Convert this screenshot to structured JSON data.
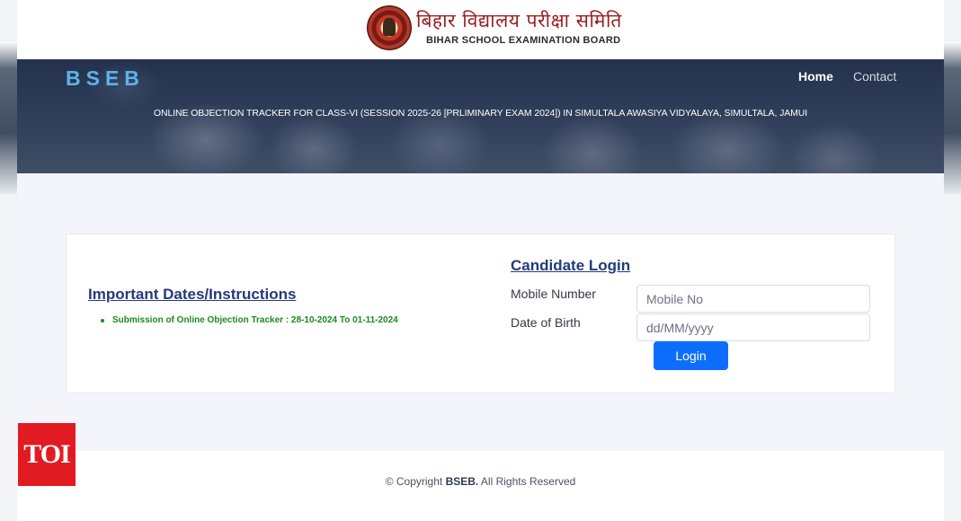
{
  "header": {
    "logo_hindi": "बिहार विद्यालय परीक्षा समिति",
    "logo_english": "BIHAR SCHOOL EXAMINATION BOARD"
  },
  "navbar": {
    "brand": "BSEB",
    "home_label": "Home",
    "contact_label": "Contact"
  },
  "hero": {
    "title": "ONLINE OBJECTION TRACKER FOR CLASS-VI (SESSION 2025-26 [PRLIMINARY EXAM 2024]) IN SIMULTALA AWASIYA VIDYALAYA, SIMULTALA, JAMUI"
  },
  "instructions": {
    "title": "Important Dates/Instructions",
    "items": [
      "Submission of Online Objection Tracker : 28-10-2024 To 01-11-2024"
    ]
  },
  "login": {
    "title": "Candidate Login",
    "mobile_label": "Mobile Number",
    "mobile_placeholder": "Mobile No",
    "dob_label": "Date of Birth",
    "dob_placeholder": "dd/MM/yyyy",
    "button_label": "Login"
  },
  "footer": {
    "prefix": "© Copyright ",
    "org": "BSEB.",
    "suffix": " All Rights Reserved"
  },
  "watermark": {
    "text": "TOI"
  },
  "colors": {
    "brand_blue": "#5db3e8",
    "heading_navy": "#233b7a",
    "instruction_green": "#1c8a1c",
    "button_blue": "#0d6efd",
    "watermark_red": "#e21b22"
  }
}
